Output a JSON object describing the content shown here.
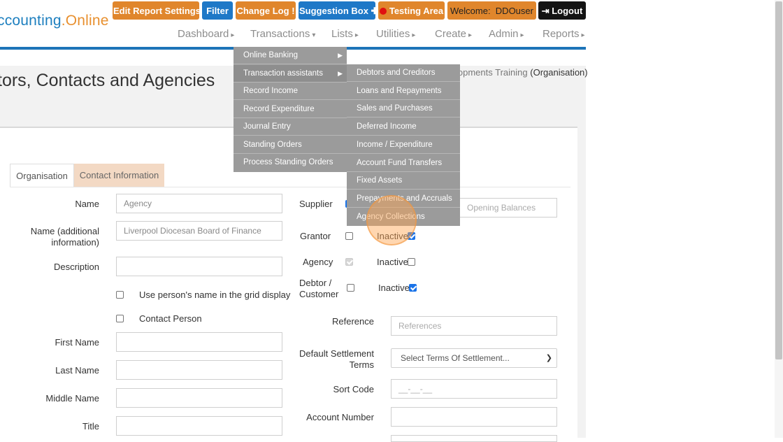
{
  "app": {
    "logo_main": "ccounting",
    "logo_dot": ".",
    "logo_online": "Online"
  },
  "toolbar": {
    "edit_report_settings": "Edit Report Settings",
    "filter": "Filter",
    "change_log": "Change Log",
    "change_log_icon": "!",
    "suggestion_box": "Suggestion Box",
    "suggestion_icon": "✚",
    "testing_area": "Testing Area",
    "welcome_label": "Welcome:",
    "welcome_user": "DDOuser",
    "logout_icon": "⇥",
    "logout": "Logout"
  },
  "nav": {
    "items": [
      "Dashboard",
      "Transactions",
      "Lists",
      "Utilities",
      "Create",
      "Admin",
      "Reports"
    ],
    "caret_down": "▾",
    "caret_right": "▸"
  },
  "page": {
    "title": "tors, Contacts and Agencies",
    "org_prefix": "lopments Training",
    "org_suffix": "(Organisation)"
  },
  "tabs": {
    "organisation": "Organisation",
    "contact_information": "Contact Information"
  },
  "form": {
    "name_label": "Name",
    "name_value": "Agency",
    "name_additional_label_1": "Name (additional",
    "name_additional_label_2": "information)",
    "name_additional_value": "Liverpool Diocesan Board of Finance",
    "description_label": "Description",
    "use_person_name_label": "Use person's name in the grid display",
    "contact_person_label": "Contact Person",
    "first_name_label": "First Name",
    "last_name_label": "Last Name",
    "middle_name_label": "Middle Name",
    "title_label": "Title",
    "supplier_label": "Supplier",
    "grantor_label": "Grantor",
    "agency_label": "Agency",
    "debtor_label_1": "Debtor /",
    "debtor_label_2": "Customer",
    "inactive_label": "Inactive",
    "opening_balances_placeholder": "Opening Balances",
    "reference_label": "Reference",
    "reference_placeholder": "References",
    "default_settlement_label_1": "Default Settlement",
    "default_settlement_label_2": "Terms",
    "settlement_select_value": "Select Terms Of Settlement...",
    "sort_code_label": "Sort Code",
    "sort_code_placeholder": "__-__-__",
    "account_number_label": "Account Number"
  },
  "transactions_menu": {
    "items": [
      "Online Banking",
      "Transaction assistants",
      "Record Income",
      "Record Expenditure",
      "Journal Entry",
      "Standing Orders",
      "Process Standing Orders"
    ],
    "submenu_arrow": "▶"
  },
  "assistants_submenu": {
    "items": [
      "Debtors and Creditors",
      "Loans and Repayments",
      "Sales and Purchases",
      "Deferred Income",
      "Income / Expenditure",
      "Account Fund Transfers",
      "Fixed Assets",
      "Prepayments and Accruals",
      "Agency Collections"
    ]
  },
  "colors": {
    "orange": "#e0862c",
    "blue": "#1e78c7",
    "menu_gray": "#9b9b9b",
    "accent_line": "#1d74b8"
  }
}
